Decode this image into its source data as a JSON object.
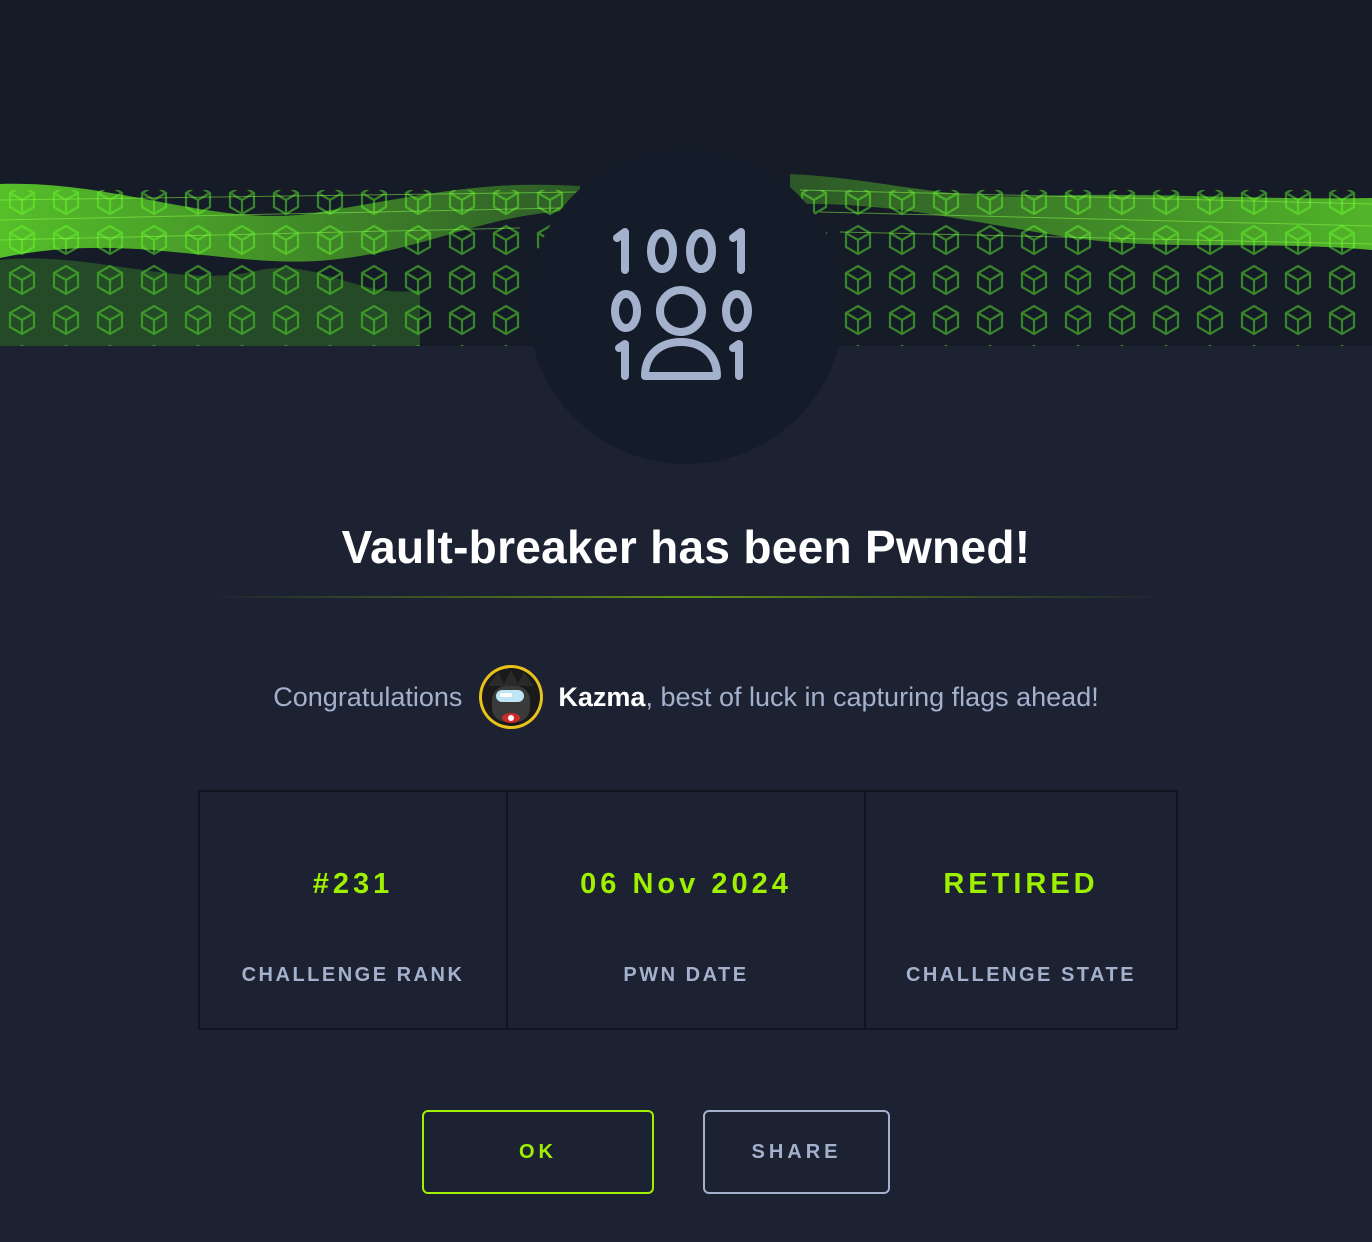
{
  "header": {
    "badge_icon": "binary-user-icon"
  },
  "title": "Vault-breaker has been Pwned!",
  "congrats": {
    "prefix": "Congratulations",
    "username": "Kazma",
    "suffix": ", best of luck in capturing flags ahead!",
    "avatar_icon": "user-avatar"
  },
  "stats": [
    {
      "value": "#231",
      "label": "CHALLENGE RANK"
    },
    {
      "value": "06 Nov 2024",
      "label": "PWN DATE"
    },
    {
      "value": "RETIRED",
      "label": "CHALLENGE STATE"
    }
  ],
  "buttons": {
    "ok": "OK",
    "share": "SHARE"
  },
  "colors": {
    "accent": "#9fef00",
    "background": "#1c2231",
    "text_muted": "#a4b1cd"
  }
}
